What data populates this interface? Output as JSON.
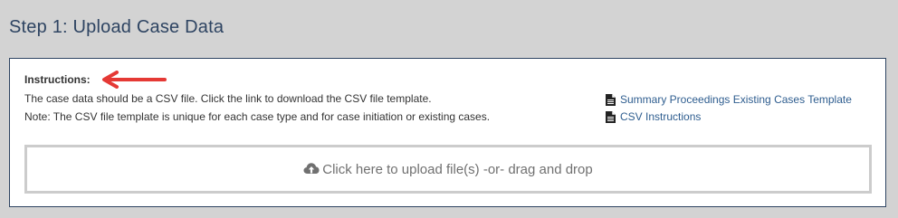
{
  "header": {
    "title": "Step 1: Upload Case Data"
  },
  "instructions": {
    "label": "Instructions:",
    "lines": [
      "The case data should be a CSV file. Click the link to download the CSV file template.",
      "Note: The CSV file template is unique for each case type and for case initiation or existing cases."
    ]
  },
  "links": [
    {
      "label": "Summary Proceedings Existing Cases Template",
      "icon": "document-icon"
    },
    {
      "label": "CSV Instructions",
      "icon": "document-icon"
    }
  ],
  "dropzone": {
    "label": "Click here to upload file(s) -or- drag and drop",
    "icon": "cloud-upload-icon"
  },
  "colors": {
    "background": "#d3d3d3",
    "title": "#2e4462",
    "panel_border": "#2e4462",
    "link": "#2e5d8f",
    "annotation_arrow": "#e53935",
    "dropzone_border": "#cccccc",
    "dropzone_text": "#707070"
  }
}
